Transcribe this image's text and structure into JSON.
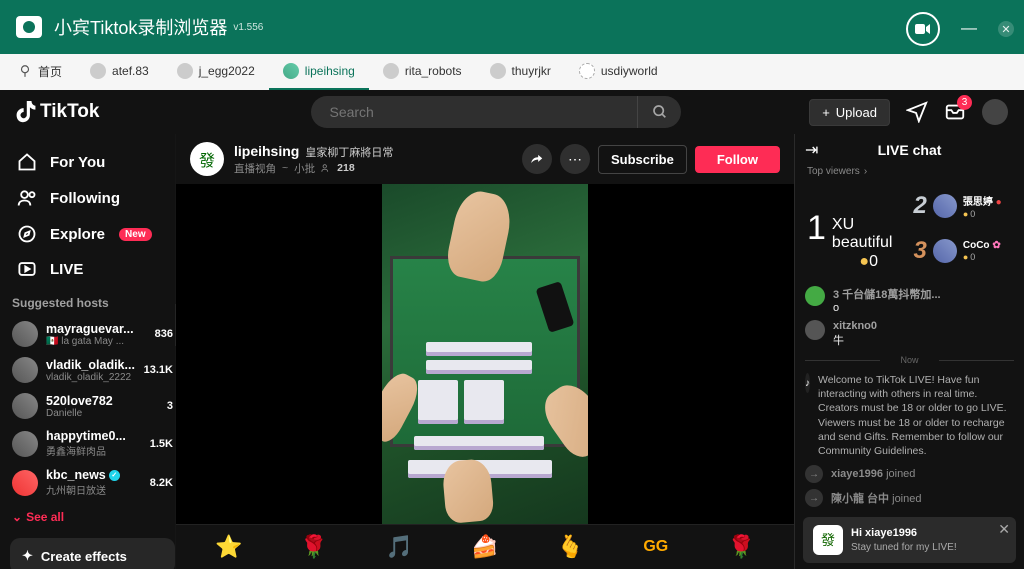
{
  "app": {
    "title": "小宾Tiktok录制浏览器",
    "version": "v1.556"
  },
  "tabs": [
    {
      "label": "首页"
    },
    {
      "label": "atef.83"
    },
    {
      "label": "j_egg2022"
    },
    {
      "label": "lipeihsing"
    },
    {
      "label": "rita_robots"
    },
    {
      "label": "thuyrjkr"
    },
    {
      "label": "usdiyworld"
    }
  ],
  "active_tab_index": 3,
  "brand": "TikTok",
  "search": {
    "placeholder": "Search"
  },
  "upload_label": "Upload",
  "inbox_badge": "3",
  "nav": {
    "for_you": "For You",
    "following": "Following",
    "explore": "Explore",
    "explore_badge": "New",
    "live": "LIVE"
  },
  "suggested_title": "Suggested hosts",
  "hosts": [
    {
      "name": "mayraguevar...",
      "sub": "🇲🇽 la gata May ...",
      "count": "836"
    },
    {
      "name": "vladik_oladik...",
      "sub": "vladik_oladik_2222",
      "count": "13.1K"
    },
    {
      "name": "520love782",
      "sub": "Danielle",
      "count": "3"
    },
    {
      "name": "happytime0...",
      "sub": "勇鑫海鲜肉品",
      "count": "1.5K"
    },
    {
      "name": "kbc_news",
      "sub": "九州朝日放送",
      "count": "8.2K",
      "verified": true
    }
  ],
  "see_all": "See all",
  "create_effects": "Create effects",
  "stream": {
    "user": "lipeihsing",
    "title": "皇家柳丁麻將日常",
    "sub1": "直播视角",
    "sub2": "小批",
    "viewers": "218",
    "subscribe": "Subscribe",
    "follow": "Follow"
  },
  "chat": {
    "title": "LIVE chat",
    "top_viewers": "Top viewers",
    "ranks": [
      {
        "num": "1",
        "name": "XU beautiful",
        "coin": "0"
      },
      {
        "num": "2",
        "name": "張思婷",
        "coin": "0"
      },
      {
        "num": "3",
        "name": "CoCo",
        "coin": "0"
      }
    ],
    "messages": [
      {
        "user": "3 千台儲18萬抖幣加...",
        "text": "o"
      },
      {
        "user": "xitzkno0",
        "text": "牛"
      }
    ],
    "now": "Now",
    "system": "Welcome to TikTok LIVE! Have fun interacting with others in real time. Creators must be 18 or older to go LIVE. Viewers must be 18 or older to recharge and send Gifts. Remember to follow our Community Guidelines.",
    "joins": [
      {
        "user": "xiaye1996",
        "suffix": "joined"
      },
      {
        "user": "陳小龍 台中",
        "suffix": "joined"
      }
    ],
    "pinned": {
      "line1": "Hi xiaye1996",
      "line2": "Stay tuned for my LIVE!"
    }
  },
  "gifts": [
    "⭐",
    "🌹",
    "🎵",
    "🍰",
    "🫰",
    "GG",
    "🌹"
  ]
}
